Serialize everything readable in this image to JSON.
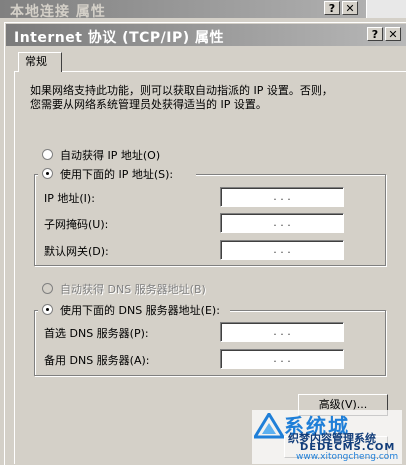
{
  "outer_window": {
    "title": "本地连接 属性",
    "help_button": "?",
    "close_button": "✕"
  },
  "dialog": {
    "title": "Internet 协议 (TCP/IP) 属性",
    "help_button": "?",
    "close_button": "✕",
    "tab_label": "常规",
    "description_line1": "如果网络支持此功能，则可以获取自动指派的 IP 设置。否则，",
    "description_line2": "您需要从网络系统管理员处获得适当的 IP 设置。"
  },
  "ip_section": {
    "auto_option": "自动获得 IP 地址(O)",
    "manual_option": "使用下面的 IP 地址(S):",
    "selected": "manual",
    "fields": [
      {
        "label": "IP 地址(I):",
        "value": ".   .   ."
      },
      {
        "label": "子网掩码(U):",
        "value": ".   .   ."
      },
      {
        "label": "默认网关(D):",
        "value": ".   .   ."
      }
    ]
  },
  "dns_section": {
    "auto_option": "自动获得 DNS 服务器地址(B)",
    "auto_disabled": true,
    "manual_option": "使用下面的 DNS 服务器地址(E):",
    "selected": "manual",
    "fields": [
      {
        "label": "首选 DNS 服务器(P):",
        "value": ".   .   ."
      },
      {
        "label": "备用 DNS 服务器(A):",
        "value": ".   .   ."
      }
    ]
  },
  "advanced_button": "高级(V)...",
  "watermark": {
    "brand": "系统城",
    "line1": "织梦内容管理系统",
    "line2": "DEDECMS.COM",
    "url": "www.xitongcheng.com",
    "color": "#1f7fd8"
  }
}
